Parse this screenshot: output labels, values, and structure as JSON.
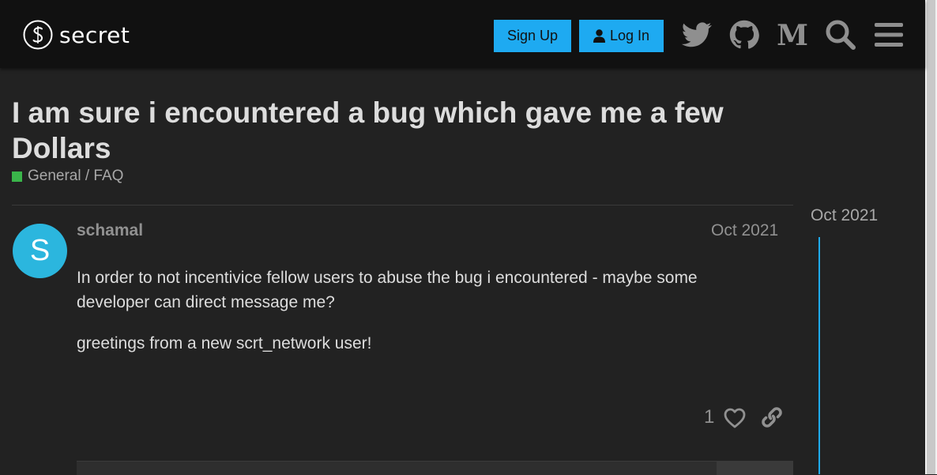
{
  "header": {
    "logo_text": "secret",
    "signup_label": "Sign Up",
    "login_label": "Log In",
    "icons": [
      "twitter-icon",
      "github-icon",
      "medium-icon",
      "search-icon",
      "menu-icon"
    ]
  },
  "topic": {
    "title": "I am sure i encountered a bug which gave me a few Dollars",
    "category": "General / FAQ",
    "category_color": "#3ab54a"
  },
  "post": {
    "avatar_letter": "S",
    "avatar_color": "#2bb6de",
    "username": "schamal",
    "date": "Oct 2021",
    "paragraphs": [
      "In order to not incentivice fellow users to abuse the bug i encountered - maybe some developer can direct message me?",
      "greetings from a new scrt_network user!"
    ],
    "like_count": "1"
  },
  "timeline": {
    "date": "Oct 2021"
  },
  "colors": {
    "accent": "#1eaaf1",
    "background": "#222222",
    "header_bg": "#111111"
  }
}
